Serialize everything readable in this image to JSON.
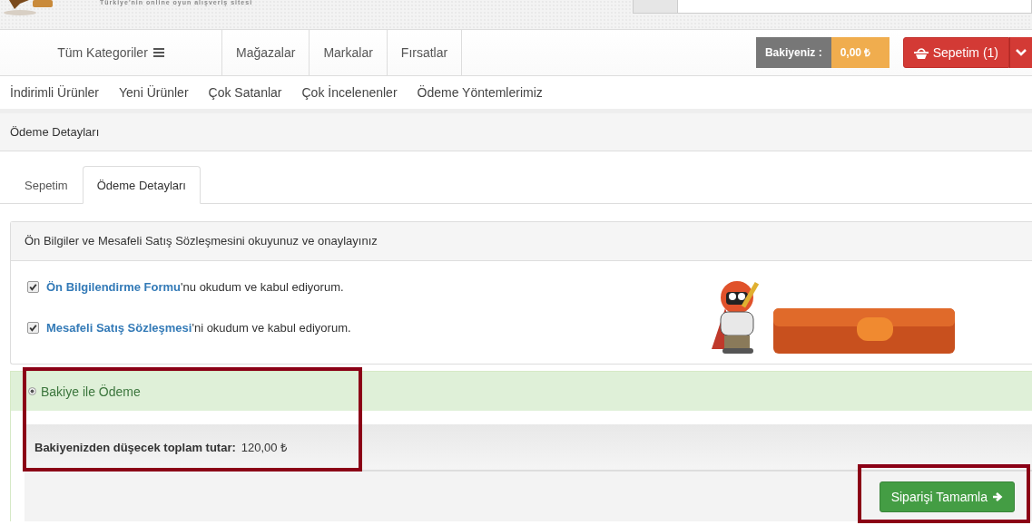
{
  "header": {
    "tagline": "Türkiye'nin online oyun alışveriş sitesi"
  },
  "nav": {
    "categories": "Tüm Kategoriler",
    "links": [
      "Mağazalar",
      "Markalar",
      "Fırsatlar"
    ],
    "balance_label": "Bakiyeniz :",
    "balance_value": "0,00 ₺",
    "cart": "Sepetim (1)"
  },
  "subnav": [
    "İndirimli Ürünler",
    "Yeni Ürünler",
    "Çok Satanlar",
    "Çok İncelenenler",
    "Ödeme Yöntemlerimiz"
  ],
  "page_title": "Ödeme Detayları",
  "tabs": [
    {
      "label": "Sepetim",
      "selected": false
    },
    {
      "label": "Ödeme Detayları",
      "selected": true
    }
  ],
  "agreement": {
    "title": "Ön Bilgiler ve Mesafeli Satış Sözleşmesini okuyunuz ve onaylayınız",
    "items": [
      {
        "link": "Ön Bilgilendirme Formu",
        "text": "'nu okudum ve kabul ediyorum.",
        "checked": true
      },
      {
        "link": "Mesafeli Satış Sözleşmesi",
        "text": "'ni okudum ve kabul ediyorum.",
        "checked": true
      }
    ]
  },
  "payment": {
    "option": "Bakiye ile Ödeme",
    "selected": true,
    "total_label": "Bakiyenizden düşecek toplam tutar:",
    "total_value": "120,00 ₺",
    "submit": "Siparişi Tamamla"
  }
}
